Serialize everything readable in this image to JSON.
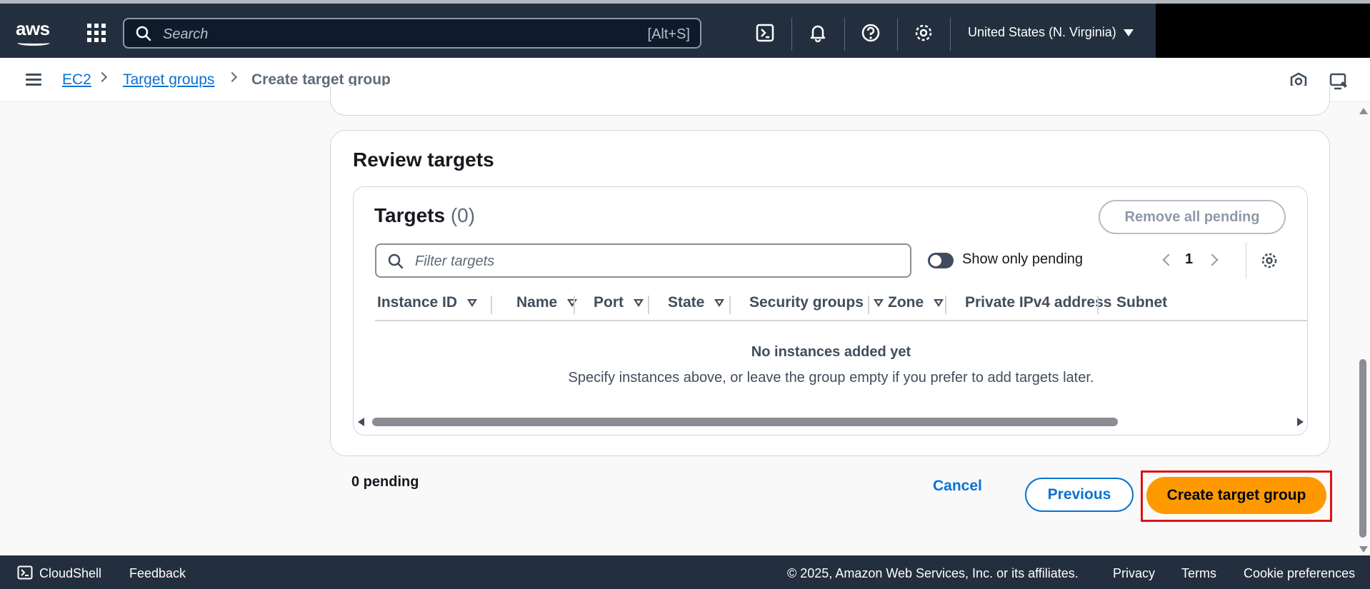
{
  "topnav": {
    "logo": "aws",
    "search_placeholder": "Search",
    "search_shortcut": "[Alt+S]",
    "region": "United States (N. Virginia)",
    "icons": [
      "cloudshell-icon",
      "bell-icon",
      "help-icon",
      "gear-icon"
    ]
  },
  "breadcrumb": {
    "items": [
      "EC2",
      "Target groups"
    ],
    "current": "Create target group"
  },
  "review": {
    "title": "Review targets",
    "targets_title": "Targets",
    "targets_count": "(0)",
    "remove_all_label": "Remove all pending",
    "filter_placeholder": "Filter targets",
    "toggle_label": "Show only pending",
    "toggle_on": true,
    "page_number": "1",
    "columns": [
      "Instance ID",
      "Name",
      "Port",
      "State",
      "Security groups",
      "Zone",
      "Private IPv4 address",
      "Subnet"
    ],
    "empty_title": "No instances added yet",
    "empty_description": "Specify instances above, or leave the group empty if you prefer to add targets later."
  },
  "actions": {
    "pending": "0 pending",
    "cancel": "Cancel",
    "previous": "Previous",
    "create": "Create target group"
  },
  "footer": {
    "cloudshell": "CloudShell",
    "feedback": "Feedback",
    "copyright": "© 2025, Amazon Web Services, Inc. or its affiliates.",
    "privacy": "Privacy",
    "terms": "Terms",
    "cookies": "Cookie preferences"
  },
  "colors": {
    "nav_bg": "#232f3e",
    "link": "#0972d3",
    "primary_button": "#ff9900",
    "highlight_border": "#d91515"
  }
}
